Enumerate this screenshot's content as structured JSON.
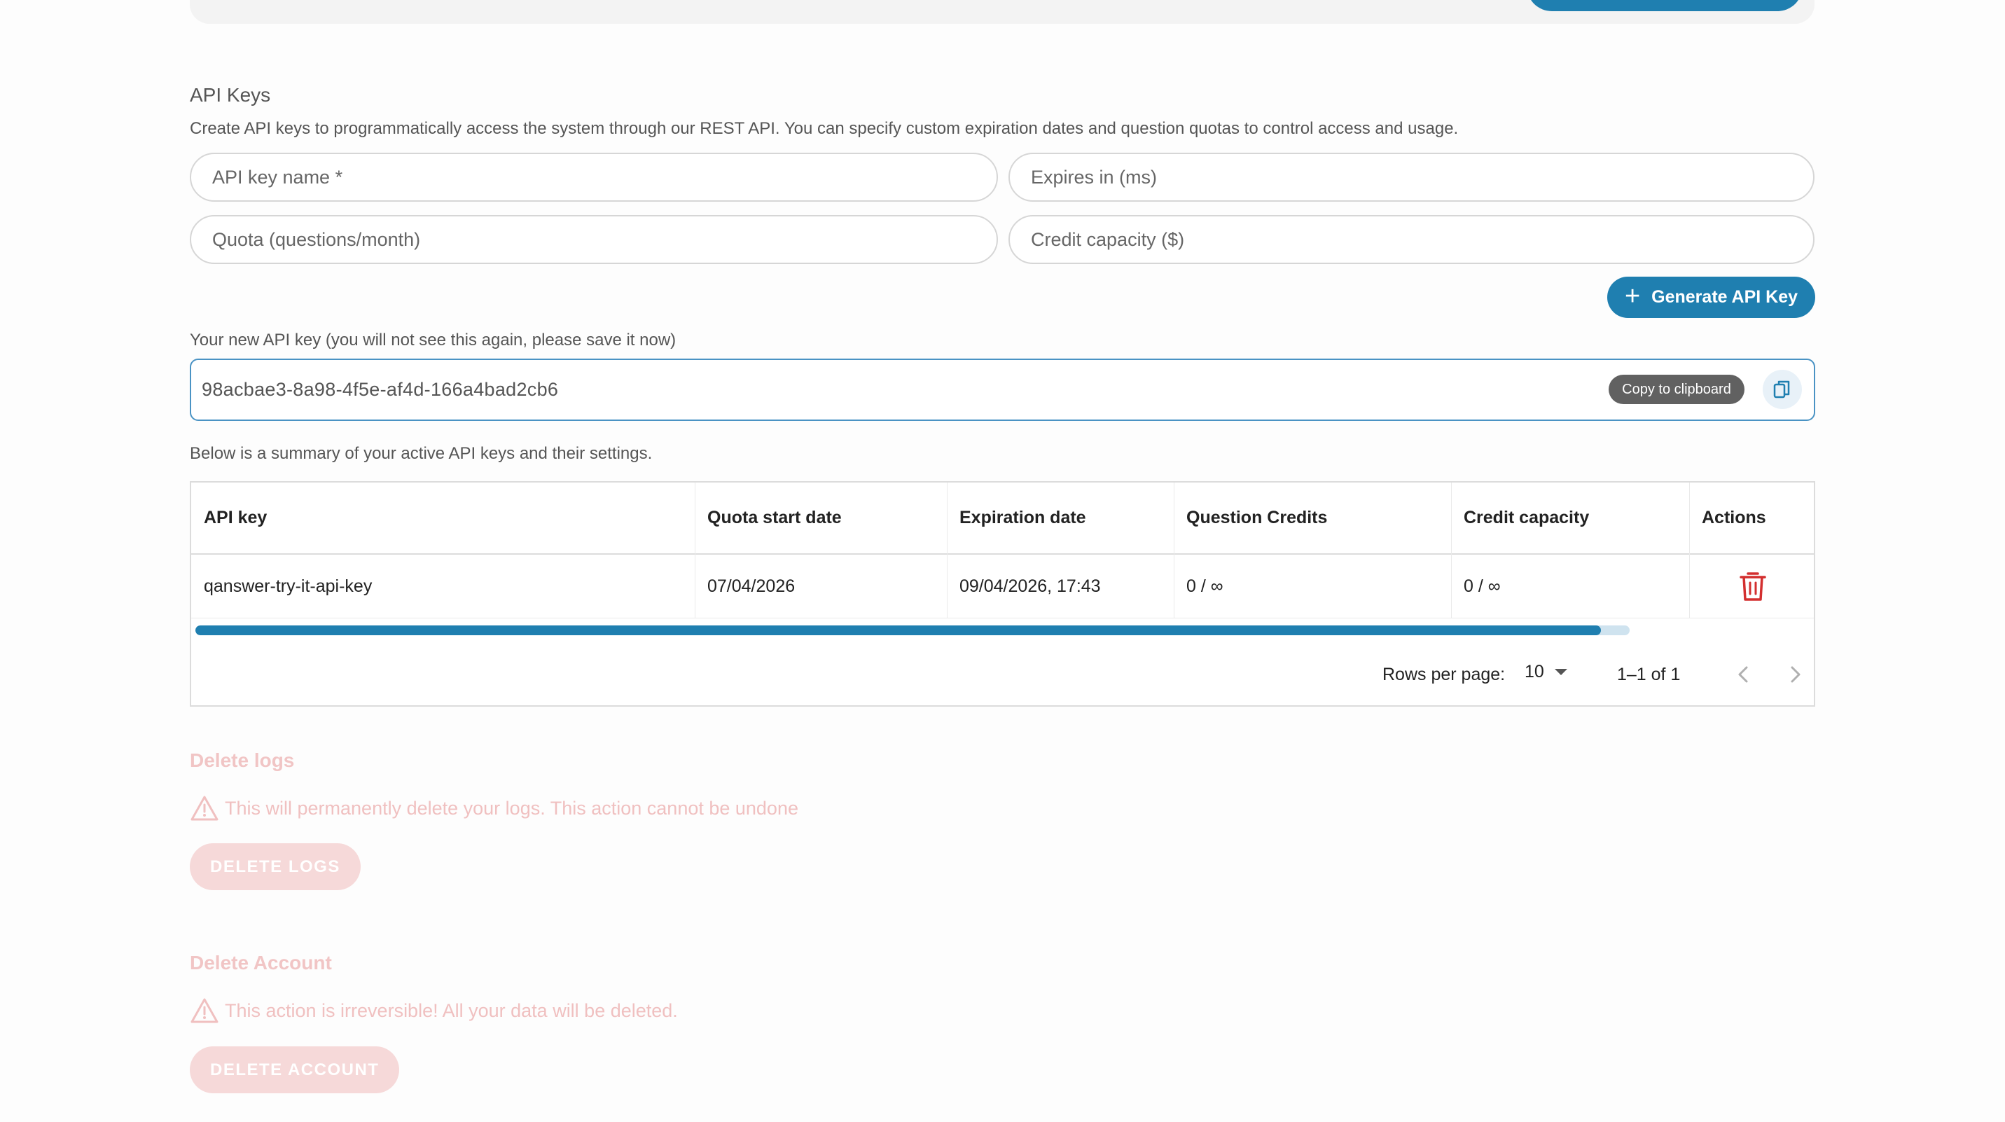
{
  "api_keys": {
    "title": "API Keys",
    "description": "Create API keys to programmatically access the system through our REST API. You can specify custom expiration dates and question quotas to control access and usage.",
    "fields": {
      "name_placeholder": "API key name *",
      "expires_placeholder": "Expires in (ms)",
      "quota_placeholder": "Quota (questions/month)",
      "credit_placeholder": "Credit capacity ($)"
    },
    "generate_button": "Generate API Key",
    "new_key_label": "Your new API key (you will not see this again, please save it now)",
    "new_key_value": "98acbae3-8a98-4f5e-af4d-166a4bad2cb6",
    "copy_tooltip": "Copy to clipboard",
    "summary_text": "Below is a summary of your active API keys and their settings."
  },
  "table": {
    "headers": [
      "API key",
      "Quota start date",
      "Expiration date",
      "Question Credits",
      "Credit capacity",
      "Actions"
    ],
    "rows": [
      {
        "api_key": "qanswer-try-it-api-key",
        "quota_start": "07/04/2026",
        "expiration": "09/04/2026, 17:43",
        "question_credits": "0 / ∞",
        "credit_capacity": "0 / ∞",
        "usage_progress": 0.98
      }
    ],
    "pagination": {
      "rows_per_page_label": "Rows per page:",
      "rows_per_page_value": "10",
      "range": "1–1 of 1"
    }
  },
  "delete_logs": {
    "title": "Delete logs",
    "warning": "This will permanently delete your logs. This action cannot be undone",
    "button": "DELETE LOGS"
  },
  "delete_account": {
    "title": "Delete Account",
    "warning": "This action is irreversible! All your data will be deleted.",
    "button": "DELETE ACCOUNT"
  },
  "colors": {
    "accent": "#1f7fb0",
    "danger_disabled": "#f6d9d9",
    "danger_icon": "#d32f2f"
  },
  "icons": [
    "plus-icon",
    "copy-icon",
    "trash-icon",
    "chevron-down-icon",
    "chevron-left-icon",
    "chevron-right-icon",
    "warning-icon"
  ]
}
